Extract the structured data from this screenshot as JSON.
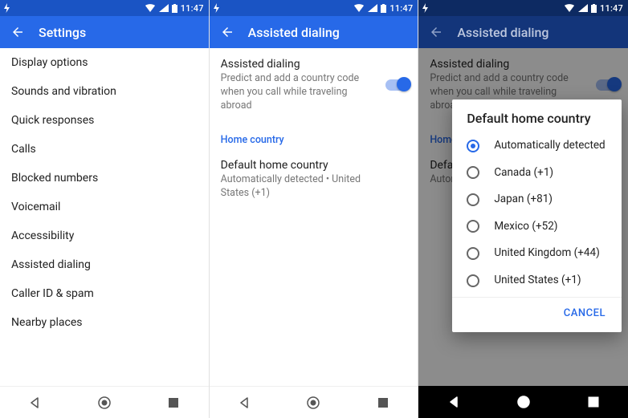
{
  "status": {
    "time": "11:47"
  },
  "screen1": {
    "title": "Settings",
    "items": [
      "Display options",
      "Sounds and vibration",
      "Quick responses",
      "Calls",
      "Blocked numbers",
      "Voicemail",
      "Accessibility",
      "Assisted dialing",
      "Caller ID & spam",
      "Nearby places"
    ]
  },
  "screen2": {
    "title": "Assisted dialing",
    "pref_title": "Assisted dialing",
    "pref_sub": "Predict and add a country code when you call while traveling abroad",
    "toggle_on": true,
    "section_label": "Home country",
    "home_title": "Default home country",
    "home_sub": "Automatically detected • United States (+1)"
  },
  "screen3": {
    "title": "Assisted dialing",
    "pref_title": "Assisted dialing",
    "pref_sub": "Predict and add a country code when you call while traveling abroad",
    "section_partial": "Home",
    "home_title": "Defa",
    "home_sub": "Autom",
    "dialog_title": "Default home country",
    "options": [
      {
        "label": "Automatically detected",
        "selected": true
      },
      {
        "label": "Canada (+1)",
        "selected": false
      },
      {
        "label": "Japan (+81)",
        "selected": false
      },
      {
        "label": "Mexico (+52)",
        "selected": false
      },
      {
        "label": "United Kingdom (+44)",
        "selected": false
      },
      {
        "label": "United States (+1)",
        "selected": false
      }
    ],
    "cancel": "CANCEL"
  }
}
